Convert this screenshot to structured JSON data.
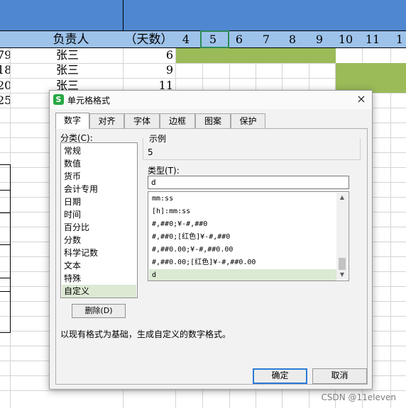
{
  "sheet": {
    "header_label": "负责人",
    "days_label": "（天数）",
    "columns": [
      "4",
      "5",
      "6",
      "7",
      "8",
      "9",
      "10",
      "11",
      "1"
    ],
    "rows": [
      {
        "left": "79",
        "name": "张三",
        "days": "6"
      },
      {
        "left": "18",
        "name": "张三",
        "days": "9"
      },
      {
        "left": "20",
        "name": "张三",
        "days": "11"
      },
      {
        "left": "25",
        "name": "",
        "days": ""
      }
    ]
  },
  "dialog": {
    "title": "单元格格式",
    "app_icon": "S",
    "close_icon": "×",
    "tabs": [
      "数字",
      "对齐",
      "字体",
      "边框",
      "图案",
      "保护"
    ],
    "active_tab": 0,
    "category_label": "分类(C):",
    "categories": [
      "常规",
      "数值",
      "货币",
      "会计专用",
      "日期",
      "时间",
      "百分比",
      "分数",
      "科学记数",
      "文本",
      "特殊",
      "自定义"
    ],
    "selected_category": 11,
    "sample_label": "示例",
    "sample_value": "5",
    "type_label": "类型(T):",
    "type_value": "d",
    "formats": [
      "mm:ss",
      "[h]:mm:ss",
      "#,##0;¥-#,##0",
      "#,##0;[红色]¥-#,##0",
      "#,##0.00;¥-#,##0.00",
      "#,##0.00;[红色]¥-#,##0.00",
      "d"
    ],
    "selected_format": 6,
    "delete_label": "删除(D)",
    "description": "以现有格式为基础，生成自定义的数字格式。",
    "ok_label": "确定",
    "cancel_label": "取消"
  },
  "watermark": "CSDN @11eleven",
  "colors": {
    "header_blue": "#4f87d0",
    "label_row": "#9ec3ea",
    "gantt_green": "#9bbb59",
    "selection": "#dce9d3",
    "ok_border": "#2c7bd6"
  }
}
